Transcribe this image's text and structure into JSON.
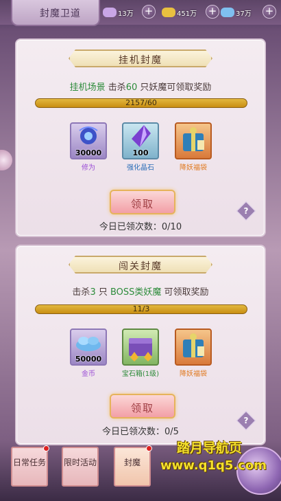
{
  "topbar": {
    "title": "封魔卫道",
    "resources": [
      {
        "icon": "purple-gem-icon",
        "value": "13万",
        "color": "#c9a6e6"
      },
      {
        "icon": "gold-ingot-icon",
        "value": "451万",
        "color": "#e8c040"
      },
      {
        "icon": "blue-crystal-icon",
        "value": "37万",
        "color": "#7fc0f0"
      }
    ],
    "plus_label": "+"
  },
  "idle": {
    "ribbon": "挂机封魔",
    "desc_scene": "挂机场景",
    "desc_pre": " 击杀",
    "desc_num": "60",
    "desc_post": " 只妖魔可领取奖励",
    "progress_text": "2157/60",
    "progress_fraction": 1.0,
    "items": [
      {
        "icon": "cultivation-orb-icon",
        "count": "30000",
        "name": "修为",
        "name_color": "#9b4fd6"
      },
      {
        "icon": "enhance-crystal-icon",
        "count": "100",
        "name": "强化晶石",
        "name_color": "#2d6fb8"
      },
      {
        "icon": "demon-gift-bag-icon",
        "count": "",
        "name": "降妖福袋",
        "name_color": "#e07a20"
      }
    ],
    "claim_label": "领取",
    "claim_count": "今日已领次数：0/10"
  },
  "boss": {
    "ribbon": "闯关封魔",
    "desc_pre": "击杀",
    "desc_num": "3",
    "desc_mid": " 只 ",
    "desc_boss": "BOSS类妖魔",
    "desc_post": " 可领取奖励",
    "progress_text": "11/3",
    "progress_fraction": 1.0,
    "items": [
      {
        "icon": "gold-coin-pile-icon",
        "count": "50000",
        "name": "金币",
        "name_color": "#9b4fd6"
      },
      {
        "icon": "gem-chest-icon",
        "count": "",
        "name": "宝石箱(1级)",
        "name_color": "#2e8b3a"
      },
      {
        "icon": "demon-gift-bag-icon",
        "count": "",
        "name": "降妖福袋",
        "name_color": "#e07a20"
      }
    ],
    "claim_label": "领取",
    "claim_count": "今日已领次数：0/5"
  },
  "help_label": "?",
  "bottom_tabs": [
    {
      "label": "日常任务"
    },
    {
      "label": "限时活动"
    },
    {
      "label": "封魔"
    }
  ],
  "watermark": {
    "line1": "踏月导航页",
    "line2": "www.q1q5.com"
  }
}
